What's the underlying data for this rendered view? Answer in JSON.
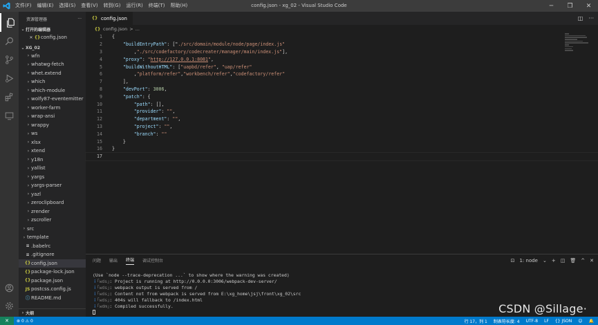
{
  "titlebar": {
    "menu": [
      "文件(F)",
      "编辑(E)",
      "选择(S)",
      "查看(V)",
      "转到(G)",
      "运行(R)",
      "终端(T)",
      "帮助(H)"
    ],
    "title": "config.json - xg_02 - Visual Studio Code"
  },
  "sidebar": {
    "title": "资源管理器",
    "more": "···",
    "open_editors": "打开的编辑器",
    "open_file": "config.json",
    "project": "XG_02",
    "folders": [
      "wfn",
      "whatwg-fetch",
      "whet.extend",
      "which",
      "which-module",
      "wolfy87-eventemitter",
      "worker-farm",
      "wrap-ansi",
      "wrappy",
      "ws",
      "xlsx",
      "xtend",
      "y18n",
      "yallist",
      "yargs",
      "yargs-parser",
      "yazl",
      "zeroclipboard",
      "zrender",
      "zscroller"
    ],
    "top_folders": [
      "src",
      "template"
    ],
    "files": [
      {
        "name": ".babelrc",
        "icon": "dot"
      },
      {
        "name": ".gitignore",
        "icon": "dot"
      },
      {
        "name": "config.json",
        "icon": "json",
        "selected": true
      },
      {
        "name": "package-lock.json",
        "icon": "json"
      },
      {
        "name": "package.json",
        "icon": "json"
      },
      {
        "name": "postcss.config.js",
        "icon": "js"
      },
      {
        "name": "README.md",
        "icon": "md"
      }
    ],
    "outline": "大纲"
  },
  "editor": {
    "tab_label": "config.json",
    "breadcrumb": [
      "config.json",
      ">",
      "..."
    ],
    "lines": [
      {
        "n": "1",
        "segs": [
          [
            "tx",
            "{"
          ]
        ]
      },
      {
        "n": "2",
        "segs": [
          [
            "tx",
            "    "
          ],
          [
            "k",
            "\"buildEntryPath\""
          ],
          [
            "tx",
            ": [\""
          ],
          [
            "s",
            "./src/domain/module/node/page/index.js\""
          ]
        ]
      },
      {
        "n": "3",
        "segs": [
          [
            "tx",
            "        ,"
          ],
          [
            "s",
            "\"./src/codefactory/codecreater/manager/main/index.js\""
          ],
          [
            "tx",
            "],"
          ]
        ]
      },
      {
        "n": "4",
        "segs": [
          [
            "tx",
            "    "
          ],
          [
            "k",
            "\"proxy\""
          ],
          [
            "tx",
            ": "
          ],
          [
            "s",
            "\""
          ],
          [
            "url",
            "http://127.0.0.1:8081"
          ],
          [
            "s",
            "\""
          ],
          [
            "tx",
            ","
          ]
        ]
      },
      {
        "n": "5",
        "segs": [
          [
            "tx",
            "    "
          ],
          [
            "k",
            "\"buildWithoutHTML\""
          ],
          [
            "tx",
            ": ["
          ],
          [
            "s",
            "\"uapbd/refer\""
          ],
          [
            "tx",
            ", "
          ],
          [
            "s",
            "\"uap/refer\""
          ]
        ]
      },
      {
        "n": "6",
        "segs": [
          [
            "tx",
            "        ,"
          ],
          [
            "s",
            "\"platform/refer\""
          ],
          [
            "tx",
            ","
          ],
          [
            "s",
            "\"workbench/refer\""
          ],
          [
            "tx",
            ","
          ],
          [
            "s",
            "\"codefactory/refer\""
          ]
        ]
      },
      {
        "n": "7",
        "segs": [
          [
            "tx",
            "    ],"
          ]
        ]
      },
      {
        "n": "8",
        "segs": [
          [
            "tx",
            "    "
          ],
          [
            "k",
            "\"devPort\""
          ],
          [
            "tx",
            ": "
          ],
          [
            "n",
            "3006"
          ],
          [
            "tx",
            ","
          ]
        ]
      },
      {
        "n": "9",
        "segs": [
          [
            "tx",
            "    "
          ],
          [
            "k",
            "\"patch\""
          ],
          [
            "tx",
            ": {"
          ]
        ]
      },
      {
        "n": "10",
        "segs": [
          [
            "tx",
            "        "
          ],
          [
            "k",
            "\"path\""
          ],
          [
            "tx",
            ": [],"
          ]
        ]
      },
      {
        "n": "11",
        "segs": [
          [
            "tx",
            "        "
          ],
          [
            "k",
            "\"provider\""
          ],
          [
            "tx",
            ": "
          ],
          [
            "s",
            "\"\""
          ],
          [
            "tx",
            ","
          ]
        ]
      },
      {
        "n": "12",
        "segs": [
          [
            "tx",
            "        "
          ],
          [
            "k",
            "\"department\""
          ],
          [
            "tx",
            ": "
          ],
          [
            "s",
            "\"\""
          ],
          [
            "tx",
            ","
          ]
        ]
      },
      {
        "n": "13",
        "segs": [
          [
            "tx",
            "        "
          ],
          [
            "k",
            "\"project\""
          ],
          [
            "tx",
            ": "
          ],
          [
            "s",
            "\"\""
          ],
          [
            "tx",
            ","
          ]
        ]
      },
      {
        "n": "14",
        "segs": [
          [
            "tx",
            "        "
          ],
          [
            "k",
            "\"branch\""
          ],
          [
            "tx",
            ": "
          ],
          [
            "s",
            "\"\""
          ]
        ]
      },
      {
        "n": "15",
        "segs": [
          [
            "tx",
            "    }"
          ]
        ]
      },
      {
        "n": "16",
        "segs": [
          [
            "tx",
            "}"
          ]
        ]
      },
      {
        "n": "17",
        "segs": [],
        "current": true
      }
    ]
  },
  "panel": {
    "tabs": [
      "问题",
      "输出",
      "终端",
      "调试控制台"
    ],
    "active_tab": "终端",
    "shell": "1: node",
    "terminal": [
      {
        "p": "",
        "t": "(Use `node --trace-deprecation ...` to show where the warning was created)"
      },
      {
        "p": "ｉ",
        "w": "｢wds｣",
        "t": ": Project is running at http://0.0.0.0:3006/webpack-dev-server/"
      },
      {
        "p": "ｉ",
        "w": "｢wds｣",
        "t": ": webpack output is served from /"
      },
      {
        "p": "ｉ",
        "w": "｢wds｣",
        "t": ": Content not from webpack is served from E:\\xg_home\\jsj\\front\\xg_02\\src"
      },
      {
        "p": "ｉ",
        "w": "｢wds｣",
        "t": ": 404s will fallback to /index.html"
      },
      {
        "p": "ｉ",
        "w": "｢wdm｣",
        "t": ": Compiled successfully."
      }
    ]
  },
  "statusbar": {
    "errors": "0",
    "warnings": "0",
    "position": "行 17，列 1",
    "indent": "制表符长度: 4",
    "encoding": "UTF-8",
    "eol": "LF",
    "language": "JSON"
  },
  "watermark": "CSDN @Sillage·"
}
